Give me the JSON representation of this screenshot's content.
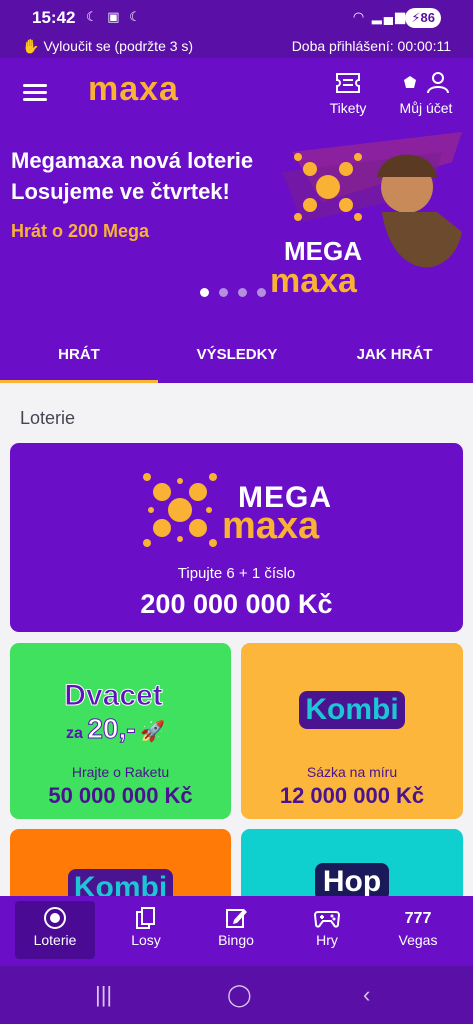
{
  "statusbar": {
    "time": "15:42",
    "battery": "86"
  },
  "session": {
    "logout_label": "Vyloučit se (podržte 3 s)",
    "duration_label": "Doba přihlášení: 00:00:11"
  },
  "header": {
    "logo": "maxa",
    "tickets_label": "Tikety",
    "account_label": "Můj účet"
  },
  "banner": {
    "line1": "Megamaxa nová loterie",
    "line2": "Losujeme ve čtvrtek!",
    "cta": "Hrát o 200 Mega",
    "art_word1": "MEGA",
    "art_word2": "maxa",
    "slide_count": 4,
    "active_slide": 1
  },
  "tabs": [
    {
      "label": "HRÁT"
    },
    {
      "label": "VÝSLEDKY"
    },
    {
      "label": "JAK HRÁT"
    }
  ],
  "section": {
    "title": "Loterie"
  },
  "games": {
    "megamaxa": {
      "logo_top": "MEGA",
      "logo_bottom": "maxa",
      "subtitle": "Tipujte 6 + 1 číslo",
      "jackpot": "200 000 000 Kč"
    },
    "dvacet": {
      "logo_line1": "Dvacet",
      "logo_za": "za",
      "logo_line2": "20,-",
      "subtitle": "Hrajte o Raketu",
      "jackpot": "50 000 000 Kč"
    },
    "kombi": {
      "logo": "Kombi",
      "subtitle": "Sázka na míru",
      "jackpot": "12 000 000 Kč"
    },
    "kombi_plus": {
      "logo": "Kombi"
    },
    "hop": {
      "logo": "Hop"
    }
  },
  "bottom_nav": [
    {
      "label": "Loterie",
      "icon": "lottery-icon"
    },
    {
      "label": "Losy",
      "icon": "tickets-icon"
    },
    {
      "label": "Bingo",
      "icon": "bingo-icon"
    },
    {
      "label": "Hry",
      "icon": "gamepad-icon"
    },
    {
      "label": "Vegas",
      "icon": "vegas-777-icon",
      "glyph": "777"
    }
  ],
  "colors": {
    "brand_purple": "#6a0fc7",
    "accent_yellow": "#f9b234",
    "dark_purple": "#4a1490"
  }
}
